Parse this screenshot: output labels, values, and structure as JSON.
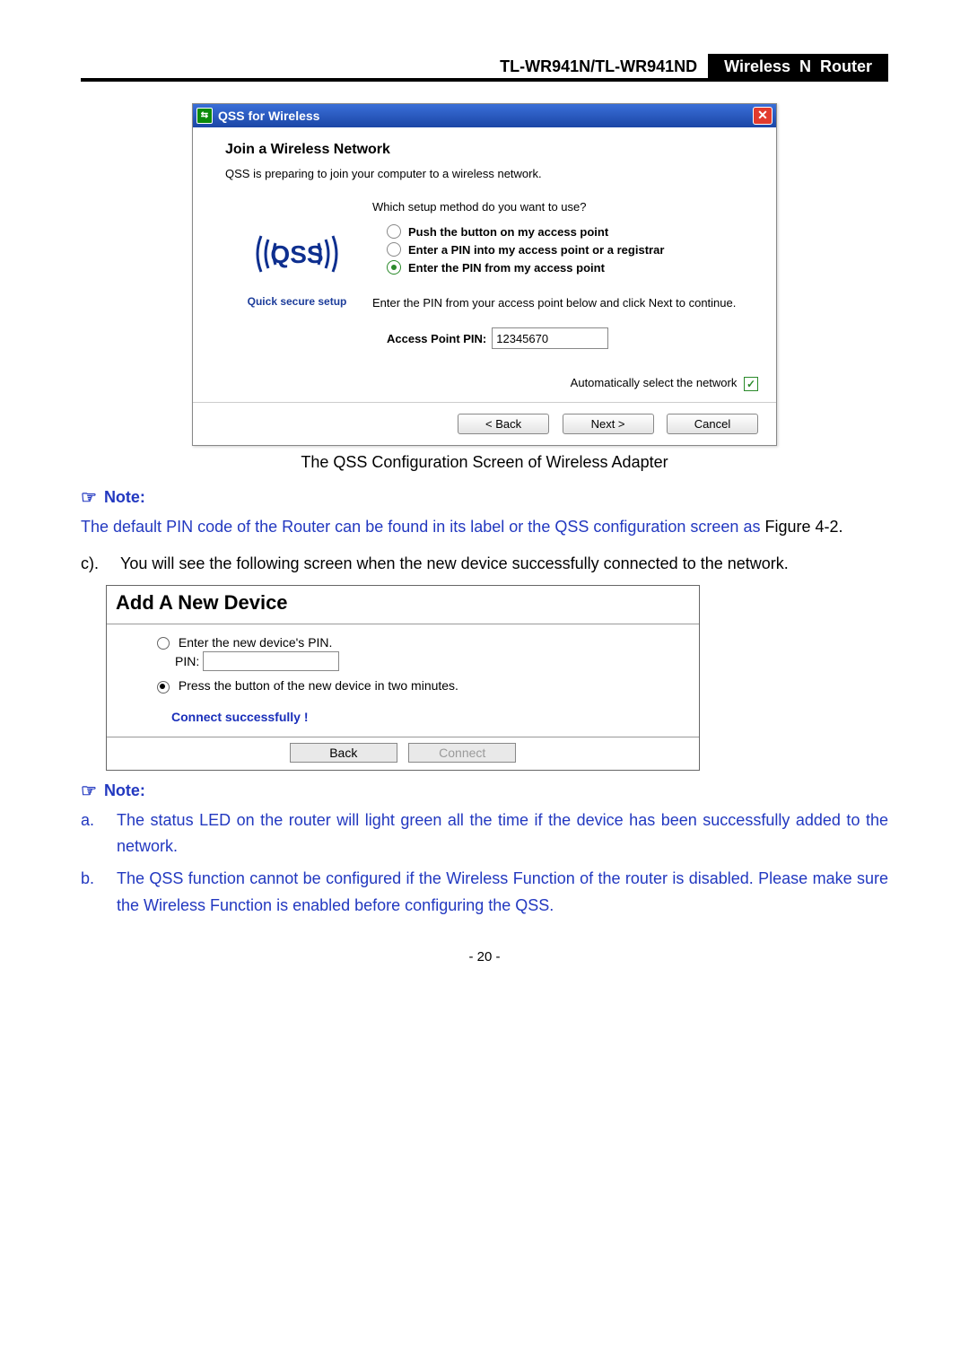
{
  "header": {
    "model": "TL-WR941N/TL-WR941ND",
    "product": "Wireless  N  Router"
  },
  "dialog": {
    "titlebar": "QSS for Wireless",
    "close_glyph": "✕",
    "heading": "Join a Wireless Network",
    "subheading": "QSS is preparing to join your computer to a wireless network.",
    "logo_caption": "Quick secure setup",
    "question": "Which setup method do you want to use?",
    "options": {
      "push": "Push the button on my access point",
      "enter_pin": "Enter a PIN into my access point or a registrar",
      "from_ap": "Enter the PIN from my access point"
    },
    "instruction": "Enter the PIN from your access point below and click Next to continue.",
    "pin_label": "Access Point PIN:",
    "pin_value": "12345670",
    "auto_label": "Automatically select the network",
    "auto_check": "✓",
    "buttons": {
      "back": "< Back",
      "next": "Next >",
      "cancel": "Cancel"
    }
  },
  "caption1": "The QSS Configuration Screen of Wireless Adapter",
  "notes": {
    "note_label": "Note:",
    "note1_blue": "The default PIN code of the Router can be found in its label or the QSS configuration screen as ",
    "note1_black": "Figure 4-2."
  },
  "step_c": {
    "marker": "c).",
    "text": "You will see the following screen when the new device successfully connected to the network."
  },
  "panel": {
    "title": "Add A New Device",
    "opt_pin": "Enter the new device's PIN.",
    "pin_label": "PIN:",
    "opt_press": "Press the button of the new device in two minutes.",
    "status": "Connect successfully !",
    "buttons": {
      "back": "Back",
      "connect": "Connect"
    }
  },
  "notes2": {
    "note_label": "Note:",
    "a_marker": "a.",
    "a_text": "The status LED on the router will light green all the time if the device has been successfully added to the network.",
    "b_marker": "b.",
    "b_text": "The QSS function cannot be configured if the Wireless Function of the router is disabled. Please make sure the Wireless Function is enabled before configuring the QSS."
  },
  "page_number": "- 20 -"
}
